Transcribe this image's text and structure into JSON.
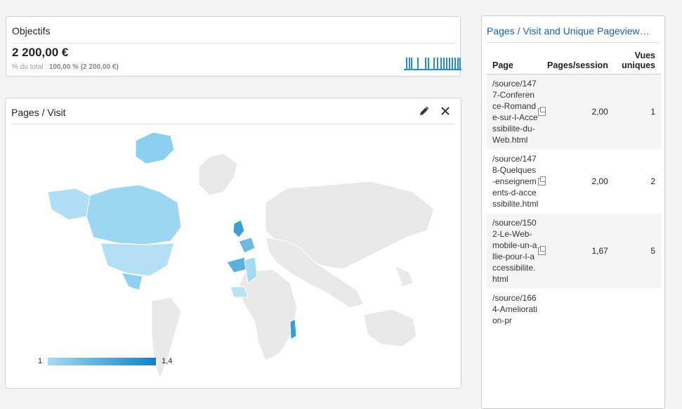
{
  "goals": {
    "title": "Objectifs",
    "value": "2 200,00 €",
    "subtitle_prefix": "% du total :",
    "subtitle_value": "100,00 % (2 200,00 €)"
  },
  "map": {
    "title": "Pages / Visit",
    "edit_icon": "pencil-icon",
    "close_icon": "close-icon",
    "legend_min": "1",
    "legend_max": "1,4",
    "colors": {
      "low": "#a8daf2",
      "high": "#0b84c4",
      "nodata": "#e9e9e9"
    }
  },
  "table": {
    "title": "Pages / Visit and Unique Pageview…",
    "headers": {
      "page": "Page",
      "pages_session": "Pages/session",
      "unique": "Vues uniques"
    },
    "rows": [
      {
        "page": "/source/1477-Conference-Romande-sur-l-Accessibilite-du-Web.html",
        "pages_session": "2,00",
        "unique": "1"
      },
      {
        "page": "/source/1478-Quelques-enseignements-d-accessibilite.html",
        "pages_session": "2,00",
        "unique": "2"
      },
      {
        "page": "/source/1502-Le-Web-mobile-un-allie-pour-l-accessibilite.html",
        "pages_session": "1,67",
        "unique": "5"
      },
      {
        "page": "/source/1664-Amelioration-pr",
        "pages_session": "",
        "unique": ""
      }
    ]
  }
}
